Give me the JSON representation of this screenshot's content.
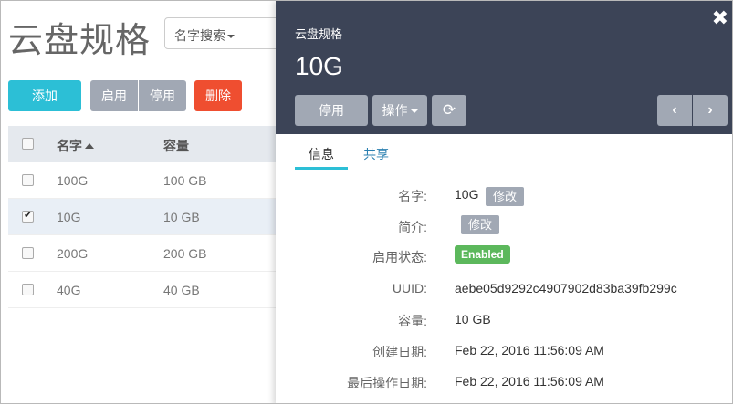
{
  "list_page": {
    "title": "云盘规格",
    "search_dropdown": "名字搜索",
    "buttons": {
      "add": "添加",
      "enable": "启用",
      "disable": "停用",
      "delete": "删除"
    },
    "columns": {
      "name": "名字",
      "capacity": "容量"
    },
    "rows": [
      {
        "name": "100G",
        "capacity": "100 GB",
        "checked": false
      },
      {
        "name": "10G",
        "capacity": "10 GB",
        "checked": true
      },
      {
        "name": "200G",
        "capacity": "200 GB",
        "checked": false
      },
      {
        "name": "40G",
        "capacity": "40 GB",
        "checked": false
      }
    ]
  },
  "detail_panel": {
    "subtitle": "云盘规格",
    "title": "10G",
    "close_glyph": "✖",
    "buttons": {
      "disable": "停用",
      "actions": "操作",
      "refresh_glyph": "⟳",
      "prev_glyph": "‹",
      "next_glyph": "›"
    },
    "tabs": {
      "info": "信息",
      "share": "共享"
    },
    "fields": {
      "name_label": "名字:",
      "name_value": "10G",
      "name_edit": "修改",
      "desc_label": "简介:",
      "desc_edit": "修改",
      "status_label": "启用状态:",
      "status_value": "Enabled",
      "uuid_label": "UUID:",
      "uuid_value": "aebe05d9292c4907902d83ba39fb299c",
      "capacity_label": "容量:",
      "capacity_value": "10 GB",
      "created_label": "创建日期:",
      "created_value": "Feb 22, 2016 11:56:09 AM",
      "updated_label": "最后操作日期:",
      "updated_value": "Feb 22, 2016 11:56:09 AM"
    }
  },
  "colors": {
    "panel_header": "#3c4457",
    "accent_cyan": "#2cbfd6",
    "danger": "#ef4e30",
    "gray_button": "#a1a8b4",
    "success": "#5cb85c"
  }
}
